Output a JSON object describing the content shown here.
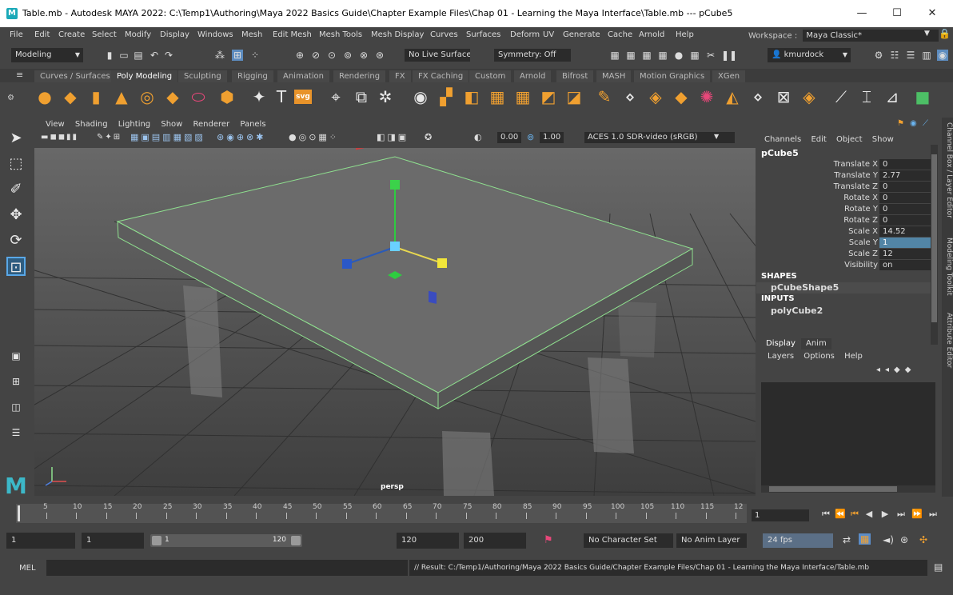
{
  "window": {
    "title": "Table.mb - Autodesk MAYA 2022: C:\\Temp1\\Authoring\\Maya 2022 Basics Guide\\Chapter Example Files\\Chap 01 - Learning the Maya Interface\\Table.mb  ---  pCube5",
    "logo_letter": "M",
    "minimize": "—",
    "maximize": "☐",
    "close": "✕"
  },
  "menubar": {
    "items": [
      "File",
      "Edit",
      "Create",
      "Select",
      "Modify",
      "Display",
      "Windows",
      "Mesh",
      "Edit Mesh",
      "Mesh Tools",
      "Mesh Display",
      "Curves",
      "Surfaces",
      "Deform",
      "UV",
      "Generate",
      "Cache",
      "Arnold",
      "Help"
    ],
    "workspace_label": "Workspace :",
    "workspace_value": "Maya Classic*"
  },
  "statusline": {
    "menuset": "Modeling",
    "live_surface": "No Live Surface",
    "symmetry": "Symmetry: Off",
    "user": "kmurdock"
  },
  "shelf": {
    "tabs": [
      "Curves / Surfaces",
      "Poly Modeling",
      "Sculpting",
      "Rigging",
      "Animation",
      "Rendering",
      "FX",
      "FX Caching",
      "Custom",
      "Arnold",
      "Bifrost",
      "MASH",
      "Motion Graphics",
      "XGen"
    ],
    "active_tab": "Poly Modeling",
    "svg_label": "svg"
  },
  "viewport": {
    "menu": [
      "View",
      "Shading",
      "Lighting",
      "Show",
      "Renderer",
      "Panels"
    ],
    "exposure": "0.00",
    "gamma": "1.00",
    "colorspace": "ACES 1.0 SDR-video (sRGB)",
    "camera": "persp"
  },
  "channelbox": {
    "menu": [
      "Channels",
      "Edit",
      "Object",
      "Show"
    ],
    "object": "pCube5",
    "attributes": [
      {
        "label": "Translate X",
        "value": "0"
      },
      {
        "label": "Translate Y",
        "value": "2.77"
      },
      {
        "label": "Translate Z",
        "value": "0"
      },
      {
        "label": "Rotate X",
        "value": "0"
      },
      {
        "label": "Rotate Y",
        "value": "0"
      },
      {
        "label": "Rotate Z",
        "value": "0"
      },
      {
        "label": "Scale X",
        "value": "14.52"
      },
      {
        "label": "Scale Y",
        "value": "1"
      },
      {
        "label": "Scale Z",
        "value": "12"
      },
      {
        "label": "Visibility",
        "value": "on"
      }
    ],
    "shapes_header": "SHAPES",
    "shape": "pCubeShape5",
    "inputs_header": "INPUTS",
    "input": "polyCube2"
  },
  "layereditor": {
    "tabs": [
      "Display",
      "Anim"
    ],
    "menu": [
      "Layers",
      "Options",
      "Help"
    ]
  },
  "side_tabs": [
    "Channel Box / Layer Editor",
    "Modeling Toolkit",
    "Attribute Editor"
  ],
  "timeslider": {
    "ticks": [
      "5",
      "10",
      "15",
      "20",
      "25",
      "30",
      "35",
      "40",
      "45",
      "50",
      "55",
      "60",
      "65",
      "70",
      "75",
      "80",
      "85",
      "90",
      "95",
      "100",
      "105",
      "110",
      "115",
      "12"
    ],
    "current_frame": "1"
  },
  "rangebar": {
    "start": "1",
    "playback_start": "1",
    "range_start": "1",
    "range_end": "120",
    "playback_end": "120",
    "end": "200",
    "character_set": "No Character Set",
    "anim_layer": "No Anim Layer",
    "fps": "24 fps"
  },
  "commandline": {
    "language": "MEL",
    "result": "// Result: C:/Temp1/Authoring/Maya 2022 Basics Guide/Chapter Example Files/Chap 01 - Learning the Maya Interface/Table.mb"
  }
}
